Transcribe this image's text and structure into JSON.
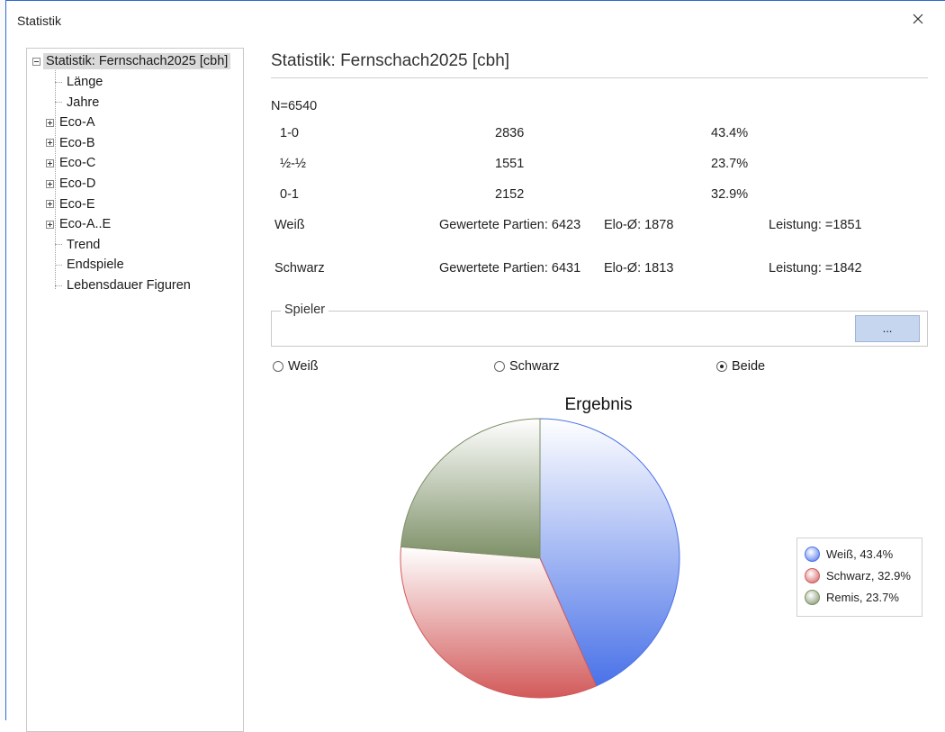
{
  "window": {
    "title": "Statistik"
  },
  "tree": {
    "root": "Statistik: Fernschach2025 [cbh]",
    "items": [
      {
        "label": "Länge",
        "expandable": false
      },
      {
        "label": "Jahre",
        "expandable": false
      },
      {
        "label": "Eco-A",
        "expandable": true
      },
      {
        "label": "Eco-B",
        "expandable": true
      },
      {
        "label": "Eco-C",
        "expandable": true
      },
      {
        "label": "Eco-D",
        "expandable": true
      },
      {
        "label": "Eco-E",
        "expandable": true
      },
      {
        "label": "Eco-A..E",
        "expandable": true
      },
      {
        "label": "Trend",
        "expandable": false
      },
      {
        "label": "Endspiele",
        "expandable": false
      },
      {
        "label": "Lebensdauer Figuren",
        "expandable": false
      }
    ]
  },
  "stats": {
    "heading": "Statistik: Fernschach2025 [cbh]",
    "n": "N=6540",
    "results": [
      {
        "label": "1-0",
        "count": "2836",
        "percent": "43.4%"
      },
      {
        "label": "½-½",
        "count": "1551",
        "percent": "23.7%"
      },
      {
        "label": "0-1",
        "count": "2152",
        "percent": "32.9%"
      }
    ],
    "white": {
      "label": "Weiß",
      "games": "Gewertete Partien: 6423",
      "elo": "Elo-Ø: 1878",
      "perf": "Leistung: =1851"
    },
    "black": {
      "label": "Schwarz",
      "games": "Gewertete Partien: 6431",
      "elo": "Elo-Ø: 1813",
      "perf": "Leistung: =1842"
    }
  },
  "spieler": {
    "legend": "Spieler",
    "button": "..."
  },
  "radios": [
    {
      "label": "Weiß",
      "checked": false
    },
    {
      "label": "Schwarz",
      "checked": false
    },
    {
      "label": "Beide",
      "checked": true
    }
  ],
  "chart_data": {
    "type": "pie",
    "title": "Ergebnis",
    "slices": [
      {
        "name": "Weiß",
        "value": 43.4,
        "label": "Weiß, 43.4%",
        "color": "#4a72e8"
      },
      {
        "name": "Schwarz",
        "value": 32.9,
        "label": "Schwarz, 32.9%",
        "color": "#d25a5a"
      },
      {
        "name": "Remis",
        "value": 23.7,
        "label": "Remis, 23.7%",
        "color": "#7d9067"
      }
    ],
    "legend_position": "right"
  },
  "colors": {
    "accent": "#2b6cd1",
    "button_bg": "#c5d6ee",
    "selected_bg": "#d9d9d9"
  }
}
